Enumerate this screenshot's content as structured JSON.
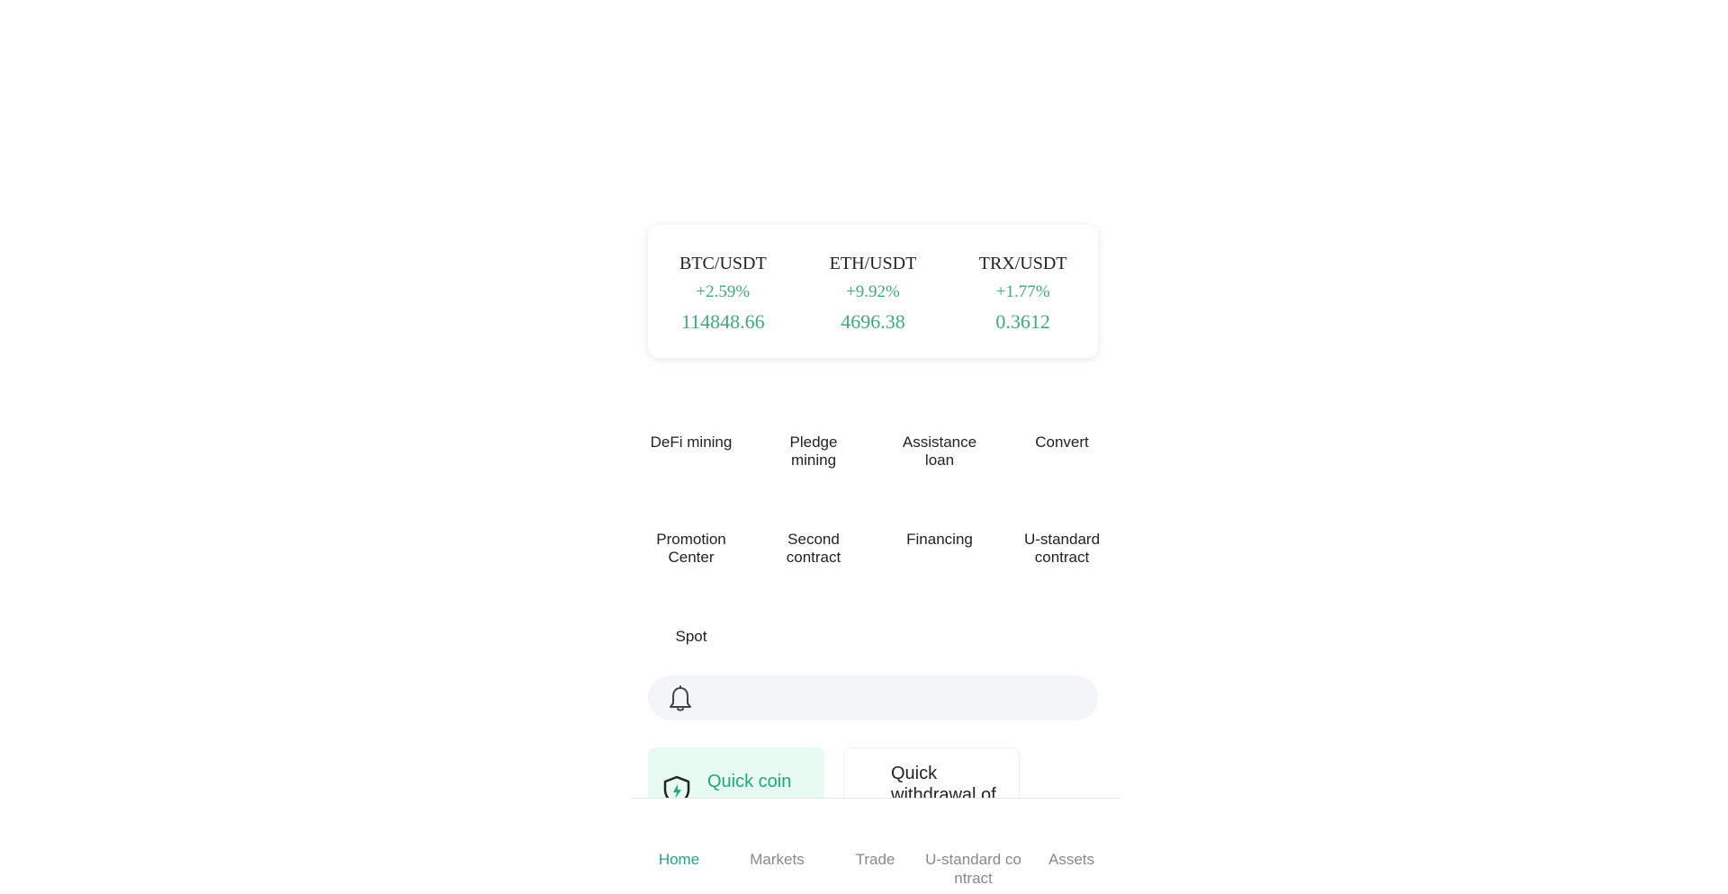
{
  "tickers": [
    {
      "pair": "BTC/USDT",
      "change": "+2.59%",
      "price": "114848.66"
    },
    {
      "pair": "ETH/USDT",
      "change": "+9.92%",
      "price": "4696.38"
    },
    {
      "pair": "TRX/USDT",
      "change": "+1.77%",
      "price": "0.3612"
    }
  ],
  "menu": {
    "items": [
      {
        "label": "DeFi mining"
      },
      {
        "label": "Pledge mining"
      },
      {
        "label": "Assistance loan"
      },
      {
        "label": "Convert"
      },
      {
        "label": "Promotion Center"
      },
      {
        "label": "Second contract"
      },
      {
        "label": "Financing"
      },
      {
        "label": "U-standard contract"
      },
      {
        "label": "Spot"
      }
    ]
  },
  "notice": {
    "icon": "bell-icon",
    "text": ""
  },
  "quick": {
    "coin_label": "Quick coin",
    "withdrawal_label": "Quick withdrawal of",
    "coin_icon": "shield-icon"
  },
  "tabbar": {
    "tabs": [
      {
        "label": "Home",
        "active": true
      },
      {
        "label": "Markets",
        "active": false
      },
      {
        "label": "Trade",
        "active": false
      },
      {
        "label": "U-standard contract",
        "active": false
      },
      {
        "label": "Assets",
        "active": false
      }
    ]
  },
  "colors": {
    "accent": "#1fa87a",
    "positive": "#3daa7a",
    "text": "#222222",
    "muted": "#888888"
  }
}
